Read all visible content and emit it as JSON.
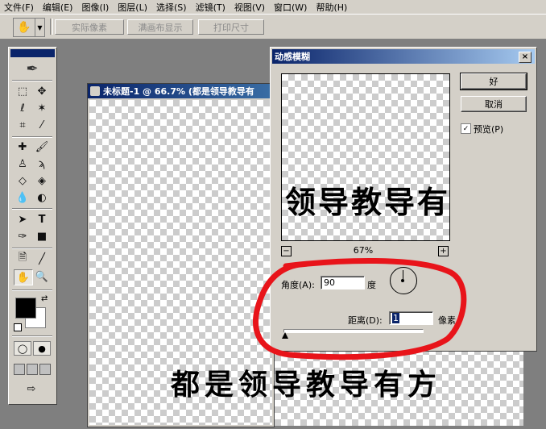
{
  "menu": [
    "文件(F)",
    "编辑(E)",
    "图像(I)",
    "图层(L)",
    "选择(S)",
    "滤镜(T)",
    "视图(V)",
    "窗口(W)",
    "帮助(H)"
  ],
  "options_bar": {
    "buttons": [
      "实际像素",
      "满画布显示",
      "打印尺寸"
    ],
    "tool_icon": "hand-icon"
  },
  "document": {
    "title": "未标题-1 @ 66.7% (都是领导教导有",
    "canvas_text": "都是领导教导有方"
  },
  "dialog": {
    "title": "动感模糊",
    "close": "×",
    "preview_text": "领导教导有",
    "zoom": "67%",
    "zoom_out": "−",
    "zoom_in": "+",
    "ok": "好",
    "cancel": "取消",
    "preview_checkbox": {
      "label": "预览(P)",
      "checked": true,
      "mark": "✓"
    },
    "angle": {
      "label": "角度(A):",
      "value": "90",
      "unit": "度"
    },
    "distance": {
      "label": "距离(D):",
      "value": "1",
      "unit": "像素"
    }
  },
  "colors": {
    "annotation": "#e8141a",
    "title_bar": "#0a246a",
    "dialog_bg": "#d4d0c8"
  },
  "tool_icons": [
    "marquee-icon",
    "move-icon",
    "lasso-icon",
    "magic-wand-icon",
    "crop-icon",
    "slice-icon",
    "healing-icon",
    "brush-icon",
    "stamp-icon",
    "history-brush-icon",
    "eraser-icon",
    "paint-bucket-icon",
    "blur-icon",
    "dodge-icon",
    "path-select-icon",
    "type-icon",
    "pen-icon",
    "shape-icon",
    "notes-icon",
    "eyedropper-icon",
    "hand-icon",
    "zoom-icon"
  ]
}
